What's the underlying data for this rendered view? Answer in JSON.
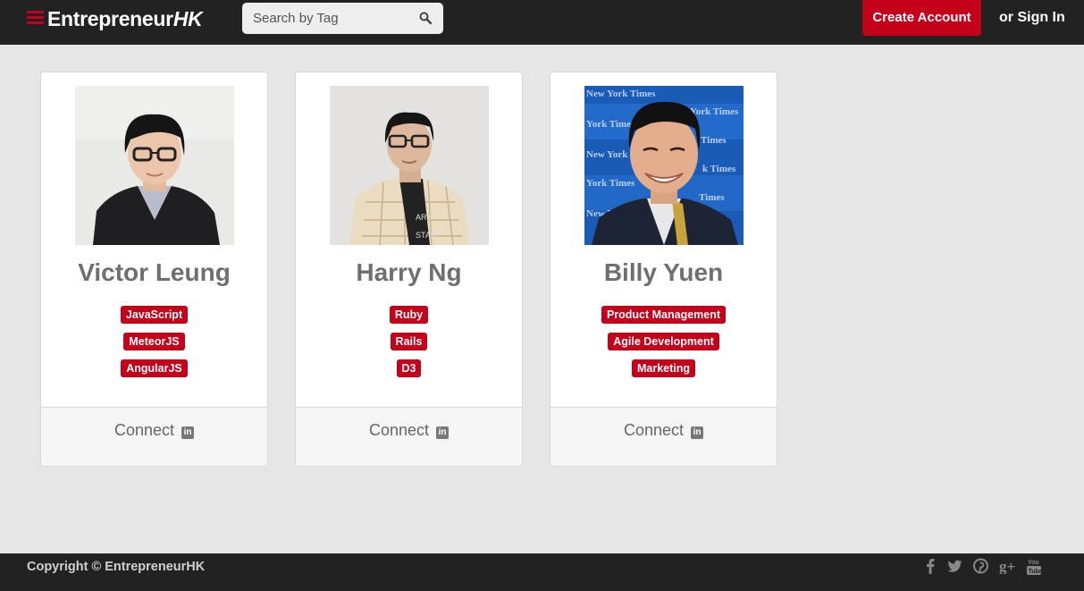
{
  "header": {
    "brand_main": "Entrepreneur",
    "brand_suffix": "HK",
    "search_placeholder": "Search by Tag",
    "create_account": "Create Account",
    "sign_in": "or Sign In"
  },
  "cards": [
    {
      "name": "Victor Leung",
      "tags": [
        "JavaScript",
        "MeteorJS",
        "AngularJS"
      ],
      "connect": "Connect"
    },
    {
      "name": "Harry Ng",
      "tags": [
        "Ruby",
        "Rails",
        "D3"
      ],
      "connect": "Connect"
    },
    {
      "name": "Billy Yuen",
      "tags": [
        "Product Management",
        "Agile Development",
        "Marketing"
      ],
      "connect": "Connect"
    }
  ],
  "footer": {
    "copyright": "Copyright © EntrepreneurHK",
    "social": [
      "facebook-icon",
      "twitter-icon",
      "pinterest-icon",
      "google-plus-icon",
      "youtube-icon"
    ]
  },
  "colors": {
    "accent": "#c5001a",
    "header_bg": "#222222",
    "page_bg": "#e6e6e6"
  }
}
